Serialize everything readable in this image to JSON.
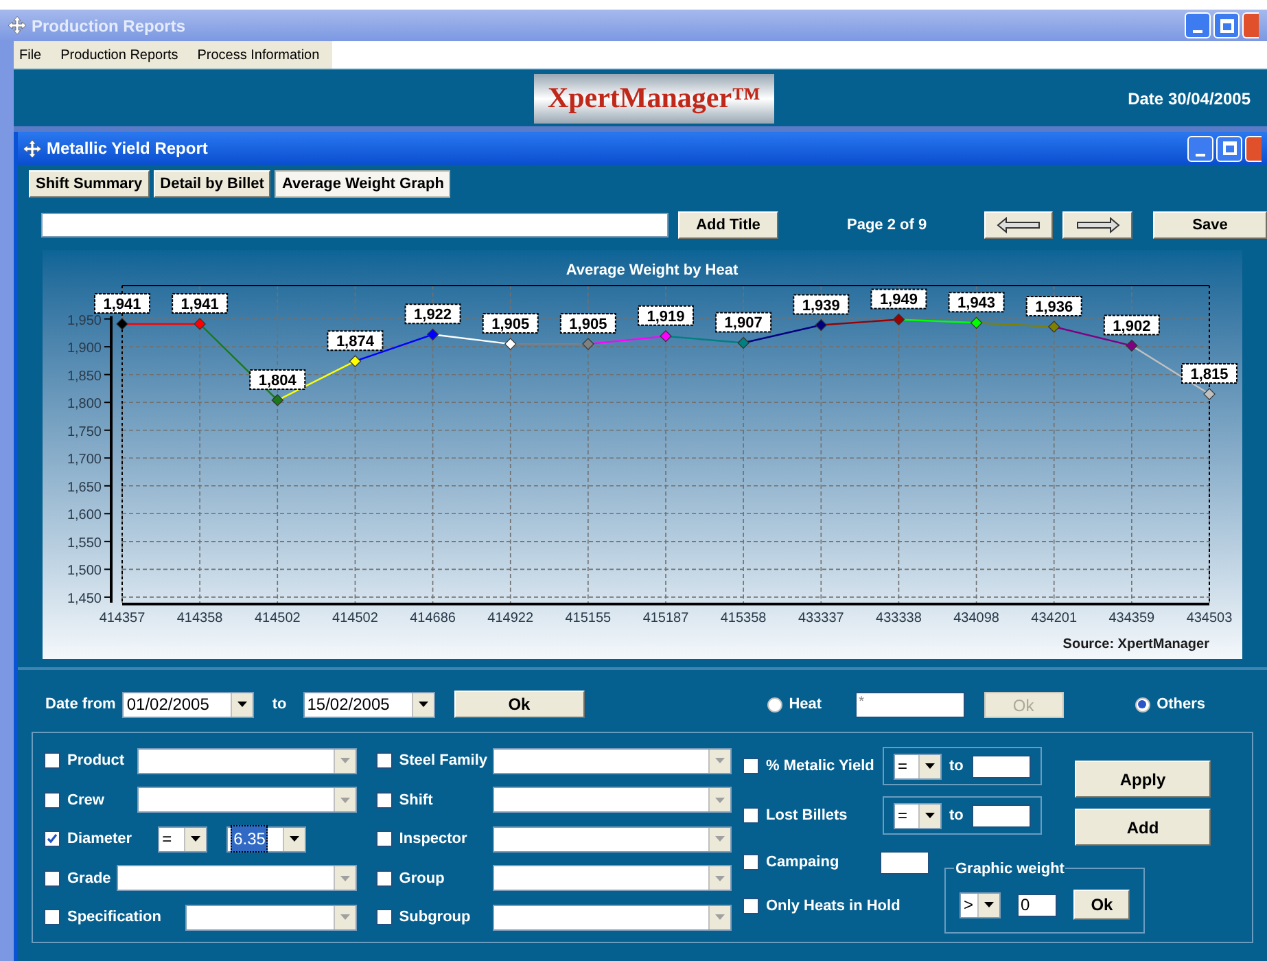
{
  "window": {
    "title": "Production Reports"
  },
  "menu": [
    {
      "label": "File"
    },
    {
      "label": "Production Reports"
    },
    {
      "label": "Process Information"
    }
  ],
  "header": {
    "logo": "XpertManager™",
    "date": "Date 30/04/2005"
  },
  "report": {
    "title": "Metallic Yield Report",
    "tabs": [
      {
        "label": "Shift Summary",
        "selected": false
      },
      {
        "label": "Detail by Billet",
        "selected": false
      },
      {
        "label": "Average Weight Graph",
        "selected": true
      }
    ],
    "add_title_button": "Add Title",
    "page": "Page 2 of 9",
    "save_button": "Save",
    "chart": {
      "source": "Source: XpertManager",
      "markers": [
        {
          "color": "#000000"
        },
        {
          "color": "#ff0000"
        },
        {
          "color": "#1a7a1a"
        },
        {
          "color": "#ffff00"
        },
        {
          "color": "#0000ff"
        },
        {
          "color": "#ffffff"
        },
        {
          "color": "#808080"
        },
        {
          "color": "#ff00ff"
        },
        {
          "color": "#008080"
        },
        {
          "color": "#000080"
        },
        {
          "color": "#990000"
        },
        {
          "color": "#00ff00"
        },
        {
          "color": "#808000"
        },
        {
          "color": "#800080"
        },
        {
          "color": "#c0c0c0"
        }
      ],
      "chart_data": {
        "type": "line",
        "title": "Average Weight by Heat",
        "categories": [
          "414357",
          "414358",
          "414502",
          "414502",
          "414686",
          "414922",
          "415155",
          "415187",
          "415358",
          "433337",
          "433338",
          "434098",
          "434201",
          "434359",
          "434503"
        ],
        "grid": true,
        "series": [
          {
            "marker": true,
            "values": [
              1941,
              1941,
              1804,
              1874,
              1922,
              1905,
              1905,
              1919,
              1907,
              1939,
              1949,
              1943,
              1936,
              1902,
              1815
            ]
          }
        ],
        "ylim": [
          1440,
          2010
        ],
        "yticks": [
          {
            "value": 1450,
            "label": "1,450"
          },
          {
            "value": 1500,
            "label": "1,500"
          },
          {
            "value": 1550,
            "label": "1,550"
          },
          {
            "value": 1600,
            "label": "1,600"
          },
          {
            "value": 1650,
            "label": "1,650"
          },
          {
            "value": 1700,
            "label": "1,700"
          },
          {
            "value": 1750,
            "label": "1,750"
          },
          {
            "value": 1800,
            "label": "1,800"
          },
          {
            "value": 1850,
            "label": "1,850"
          },
          {
            "value": 1900,
            "label": "1,900"
          },
          {
            "value": 1950,
            "label": "1,950"
          }
        ],
        "value_labels": [
          "1,941",
          "1,941",
          "1,804",
          "1,874",
          "1,922",
          "1,905",
          "1,905",
          "1,919",
          "1,907",
          "1,939",
          "1,949",
          "1,943",
          "1,936",
          "1,902",
          "1,815"
        ]
      }
    }
  },
  "filters": {
    "date_from_label": "Date from",
    "date_from": "01/02/2005",
    "to_label": "to",
    "date_to": "15/02/2005",
    "ok_button": "Ok",
    "mode": [
      {
        "label": "Heat",
        "selected": false
      },
      {
        "label": "Others",
        "selected": true
      }
    ],
    "heat_value": "*",
    "heat_ok": {
      "label": "Ok",
      "disabled": true
    },
    "columns": [
      [
        {
          "label": "Product",
          "checked": false,
          "kind": "combo"
        },
        {
          "label": "Crew",
          "checked": false,
          "kind": "combo"
        },
        {
          "label": "Diameter",
          "checked": true,
          "kind": "compare",
          "operator": "=",
          "value": "6.35"
        },
        {
          "label": "Grade",
          "checked": false,
          "kind": "combo"
        },
        {
          "label": "Specification",
          "checked": false,
          "kind": "combo"
        }
      ],
      [
        {
          "label": "Steel Family",
          "checked": false,
          "kind": "combo"
        },
        {
          "label": "Shift",
          "checked": false,
          "kind": "combo"
        },
        {
          "label": "Inspector",
          "checked": false,
          "kind": "combo"
        },
        {
          "label": "Group",
          "checked": false,
          "kind": "combo"
        },
        {
          "label": "Subgroup",
          "checked": false,
          "kind": "combo"
        }
      ]
    ],
    "extras": [
      {
        "label": "% Metalic Yield",
        "checked": false,
        "kind": "range",
        "operator": "=",
        "to_label": "to"
      },
      {
        "label": "Lost Billets",
        "checked": false,
        "kind": "range",
        "operator": "=",
        "to_label": "to"
      },
      {
        "label": "Campaing",
        "checked": false,
        "kind": "text"
      },
      {
        "label": "Only Heats in Hold",
        "checked": false,
        "kind": "plain"
      }
    ],
    "apply_button": "Apply",
    "add_button": "Add",
    "graphic_weight": {
      "legend": "Graphic weight",
      "operator": ">",
      "value": "0",
      "ok_button": "Ok"
    }
  }
}
